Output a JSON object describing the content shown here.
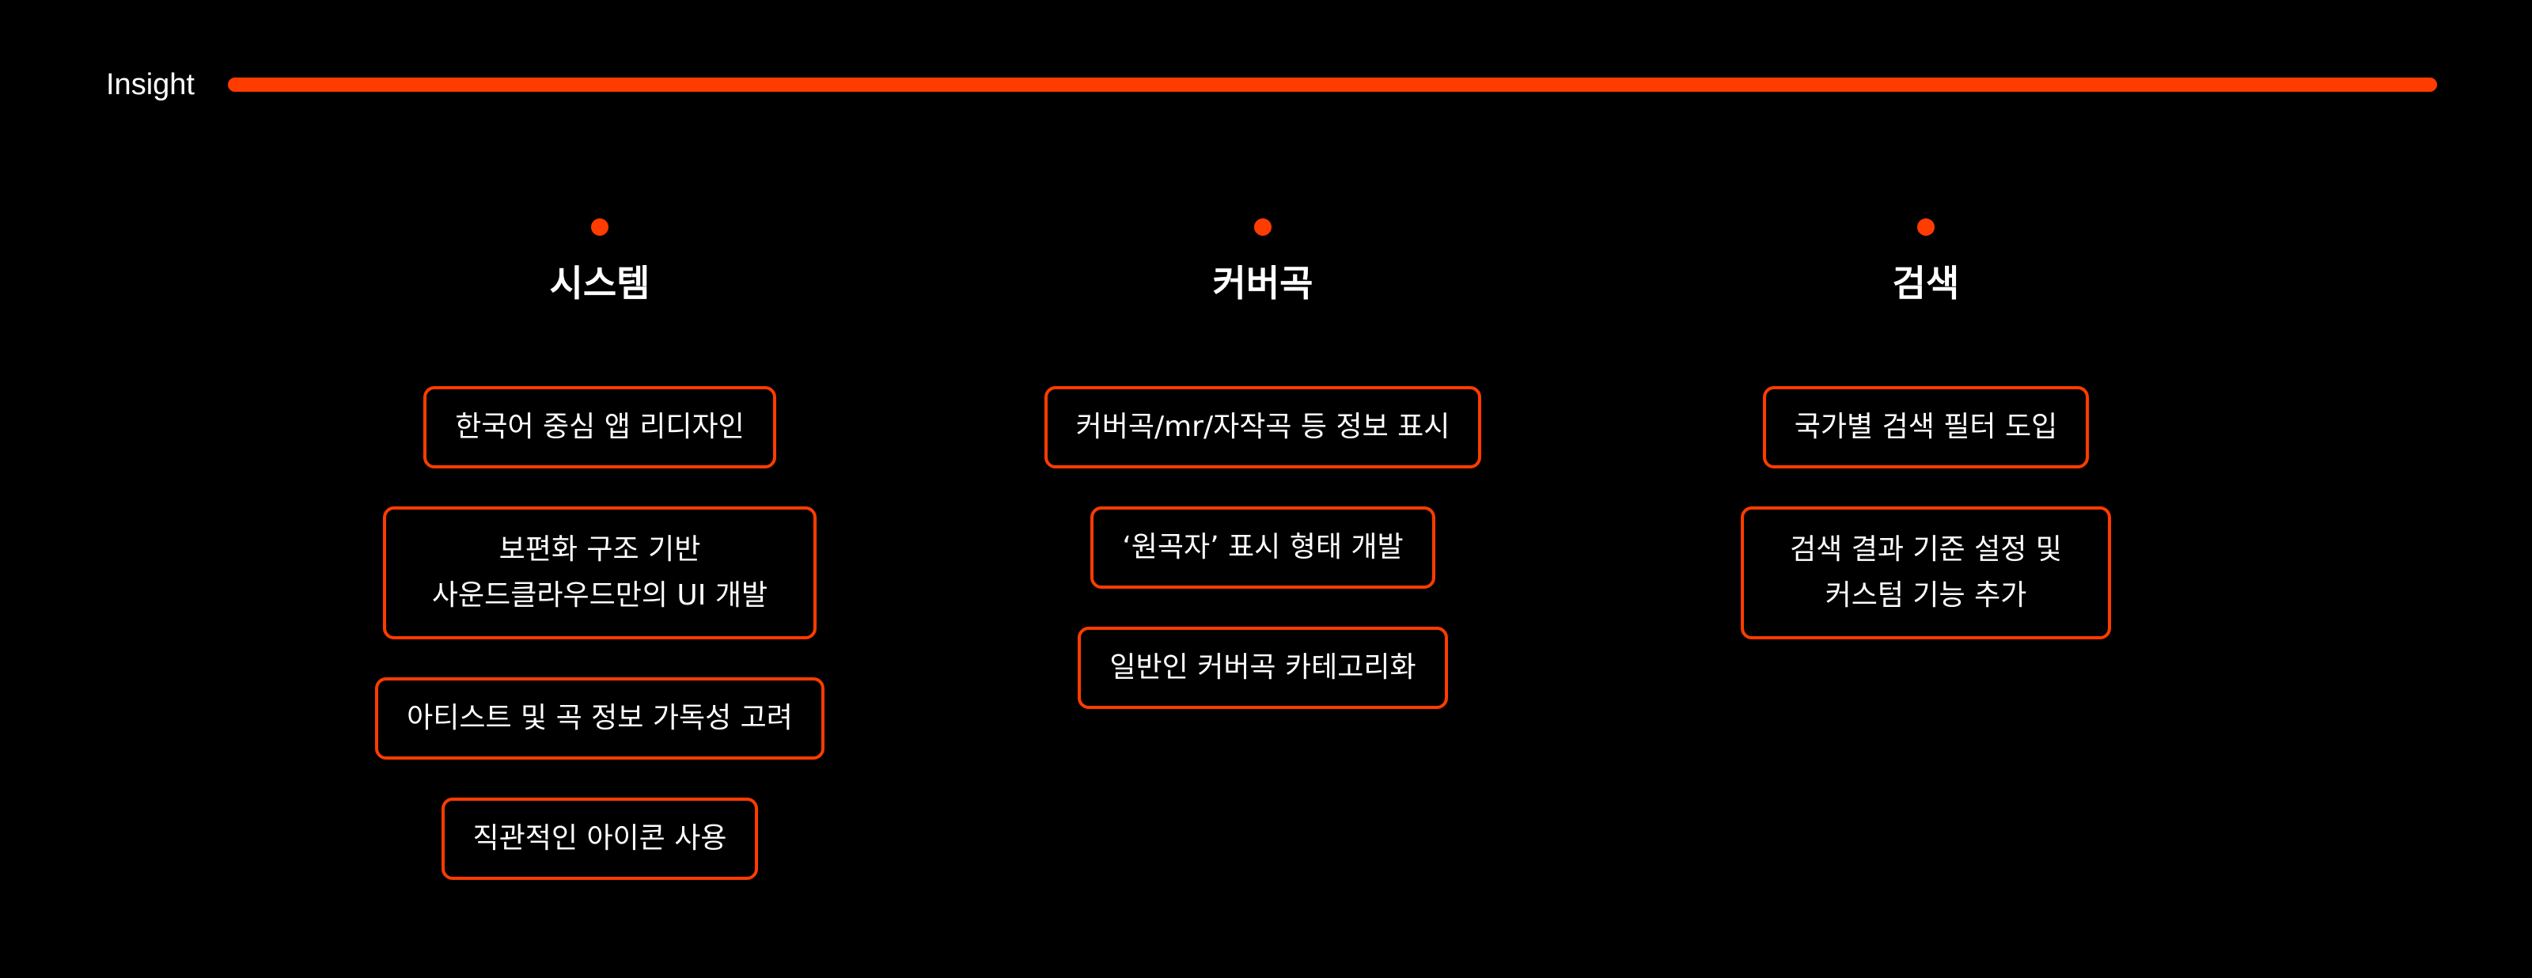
{
  "header": {
    "label": "Insight",
    "accent_color": "#ff3c00"
  },
  "columns": [
    {
      "title": "시스템",
      "items": [
        {
          "lines": [
            "한국어 중심 앱 리디자인"
          ]
        },
        {
          "lines": [
            "보편화 구조 기반",
            "사운드클라우드만의 UI 개발"
          ]
        },
        {
          "lines": [
            "아티스트 및 곡 정보 가독성 고려"
          ]
        },
        {
          "lines": [
            "직관적인 아이콘 사용"
          ]
        }
      ]
    },
    {
      "title": "커버곡",
      "items": [
        {
          "lines": [
            "커버곡/mr/자작곡 등 정보 표시"
          ]
        },
        {
          "lines": [
            "‘원곡자’ 표시 형태 개발"
          ]
        },
        {
          "lines": [
            "일반인 커버곡 카테고리화"
          ]
        }
      ]
    },
    {
      "title": "검색",
      "items": [
        {
          "lines": [
            "국가별 검색 필터 도입"
          ]
        },
        {
          "lines": [
            "검색 결과 기준 설정 및",
            "커스텀 기능 추가"
          ]
        }
      ]
    }
  ]
}
